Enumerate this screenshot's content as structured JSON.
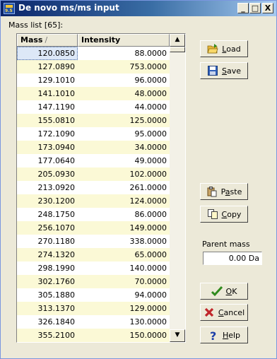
{
  "window": {
    "title": "De novo ms/ms input",
    "app_icon_text": "9.5"
  },
  "titlebar_buttons": {
    "minimize": "_",
    "maximize": "□",
    "close": "X"
  },
  "mass_list_label": "Mass list [65]:",
  "table": {
    "columns": [
      "Mass",
      "Intensity"
    ],
    "sort_indicator": "/",
    "rows": [
      {
        "mass": "120.0850",
        "intensity": "88.0000"
      },
      {
        "mass": "127.0890",
        "intensity": "753.0000"
      },
      {
        "mass": "129.1010",
        "intensity": "96.0000"
      },
      {
        "mass": "141.1010",
        "intensity": "48.0000"
      },
      {
        "mass": "147.1190",
        "intensity": "44.0000"
      },
      {
        "mass": "155.0810",
        "intensity": "125.0000"
      },
      {
        "mass": "172.1090",
        "intensity": "95.0000"
      },
      {
        "mass": "173.0940",
        "intensity": "34.0000"
      },
      {
        "mass": "177.0640",
        "intensity": "49.0000"
      },
      {
        "mass": "205.0930",
        "intensity": "102.0000"
      },
      {
        "mass": "213.0920",
        "intensity": "261.0000"
      },
      {
        "mass": "230.1200",
        "intensity": "124.0000"
      },
      {
        "mass": "248.1750",
        "intensity": "86.0000"
      },
      {
        "mass": "256.1070",
        "intensity": "149.0000"
      },
      {
        "mass": "270.1180",
        "intensity": "338.0000"
      },
      {
        "mass": "274.1320",
        "intensity": "65.0000"
      },
      {
        "mass": "298.1990",
        "intensity": "140.0000"
      },
      {
        "mass": "302.1760",
        "intensity": "70.0000"
      },
      {
        "mass": "305.1880",
        "intensity": "94.0000"
      },
      {
        "mass": "313.1370",
        "intensity": "129.0000"
      },
      {
        "mass": "326.1840",
        "intensity": "130.0000"
      },
      {
        "mass": "355.2100",
        "intensity": "150.0000"
      }
    ]
  },
  "buttons": {
    "load": {
      "mnemonic": "L",
      "rest": "oad",
      "icon": "folder-open-icon"
    },
    "save": {
      "mnemonic": "S",
      "rest": "ave",
      "icon": "floppy-disk-icon"
    },
    "paste": {
      "pre": "P",
      "mnemonic": "a",
      "rest": "ste",
      "icon": "paste-icon"
    },
    "copy": {
      "mnemonic": "C",
      "rest": "opy",
      "icon": "copy-icon"
    },
    "ok": {
      "mnemonic": "O",
      "rest": "K",
      "icon": "checkmark-icon"
    },
    "cancel": {
      "mnemonic": "C",
      "rest": "ancel",
      "icon": "cross-icon"
    },
    "help": {
      "mnemonic": "H",
      "rest": "elp",
      "icon": "question-icon"
    }
  },
  "parent_mass": {
    "label": "Parent mass",
    "value": "0.00 Da"
  },
  "colors": {
    "title_gradient_start": "#0a246a",
    "row_highlight": "#fbf9d6",
    "ok_check": "#2f8a1d",
    "cancel_x": "#c0262a",
    "help_q": "#1c3fa8"
  }
}
